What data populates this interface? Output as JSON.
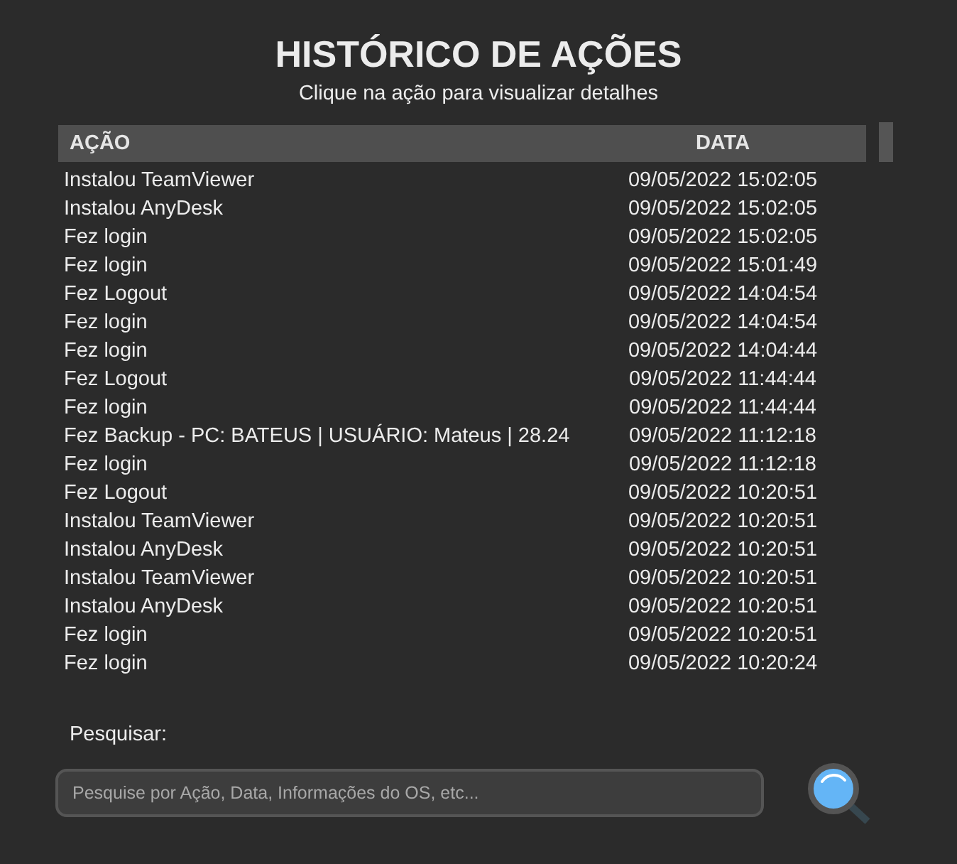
{
  "title": "HISTÓRICO DE AÇÕES",
  "subtitle": "Clique na ação para visualizar detalhes",
  "table": {
    "columns": [
      "AÇÃO",
      "DATA"
    ],
    "rows": [
      {
        "action": "Instalou TeamViewer",
        "date": "09/05/2022 15:02:05"
      },
      {
        "action": "Instalou AnyDesk",
        "date": "09/05/2022 15:02:05"
      },
      {
        "action": "Fez login",
        "date": "09/05/2022 15:02:05"
      },
      {
        "action": "Fez login",
        "date": "09/05/2022 15:01:49"
      },
      {
        "action": "Fez Logout",
        "date": "09/05/2022 14:04:54"
      },
      {
        "action": "Fez login",
        "date": "09/05/2022 14:04:54"
      },
      {
        "action": "Fez login",
        "date": "09/05/2022 14:04:44"
      },
      {
        "action": "Fez Logout",
        "date": "09/05/2022 11:44:44"
      },
      {
        "action": "Fez login",
        "date": "09/05/2022 11:44:44"
      },
      {
        "action": "Fez Backup - PC: BATEUS | USUÁRIO: Mateus | 28.24",
        "date": "09/05/2022 11:12:18"
      },
      {
        "action": "Fez login",
        "date": "09/05/2022 11:12:18"
      },
      {
        "action": "Fez Logout",
        "date": "09/05/2022 10:20:51"
      },
      {
        "action": "Instalou TeamViewer",
        "date": "09/05/2022 10:20:51"
      },
      {
        "action": "Instalou AnyDesk",
        "date": "09/05/2022 10:20:51"
      },
      {
        "action": "Instalou TeamViewer",
        "date": "09/05/2022 10:20:51"
      },
      {
        "action": "Instalou AnyDesk",
        "date": "09/05/2022 10:20:51"
      },
      {
        "action": "Fez login",
        "date": "09/05/2022 10:20:51"
      },
      {
        "action": "Fez login",
        "date": "09/05/2022 10:20:24"
      }
    ]
  },
  "search": {
    "label": "Pesquisar:",
    "placeholder": "Pesquise por Ação, Data, Informações do OS, etc..."
  }
}
